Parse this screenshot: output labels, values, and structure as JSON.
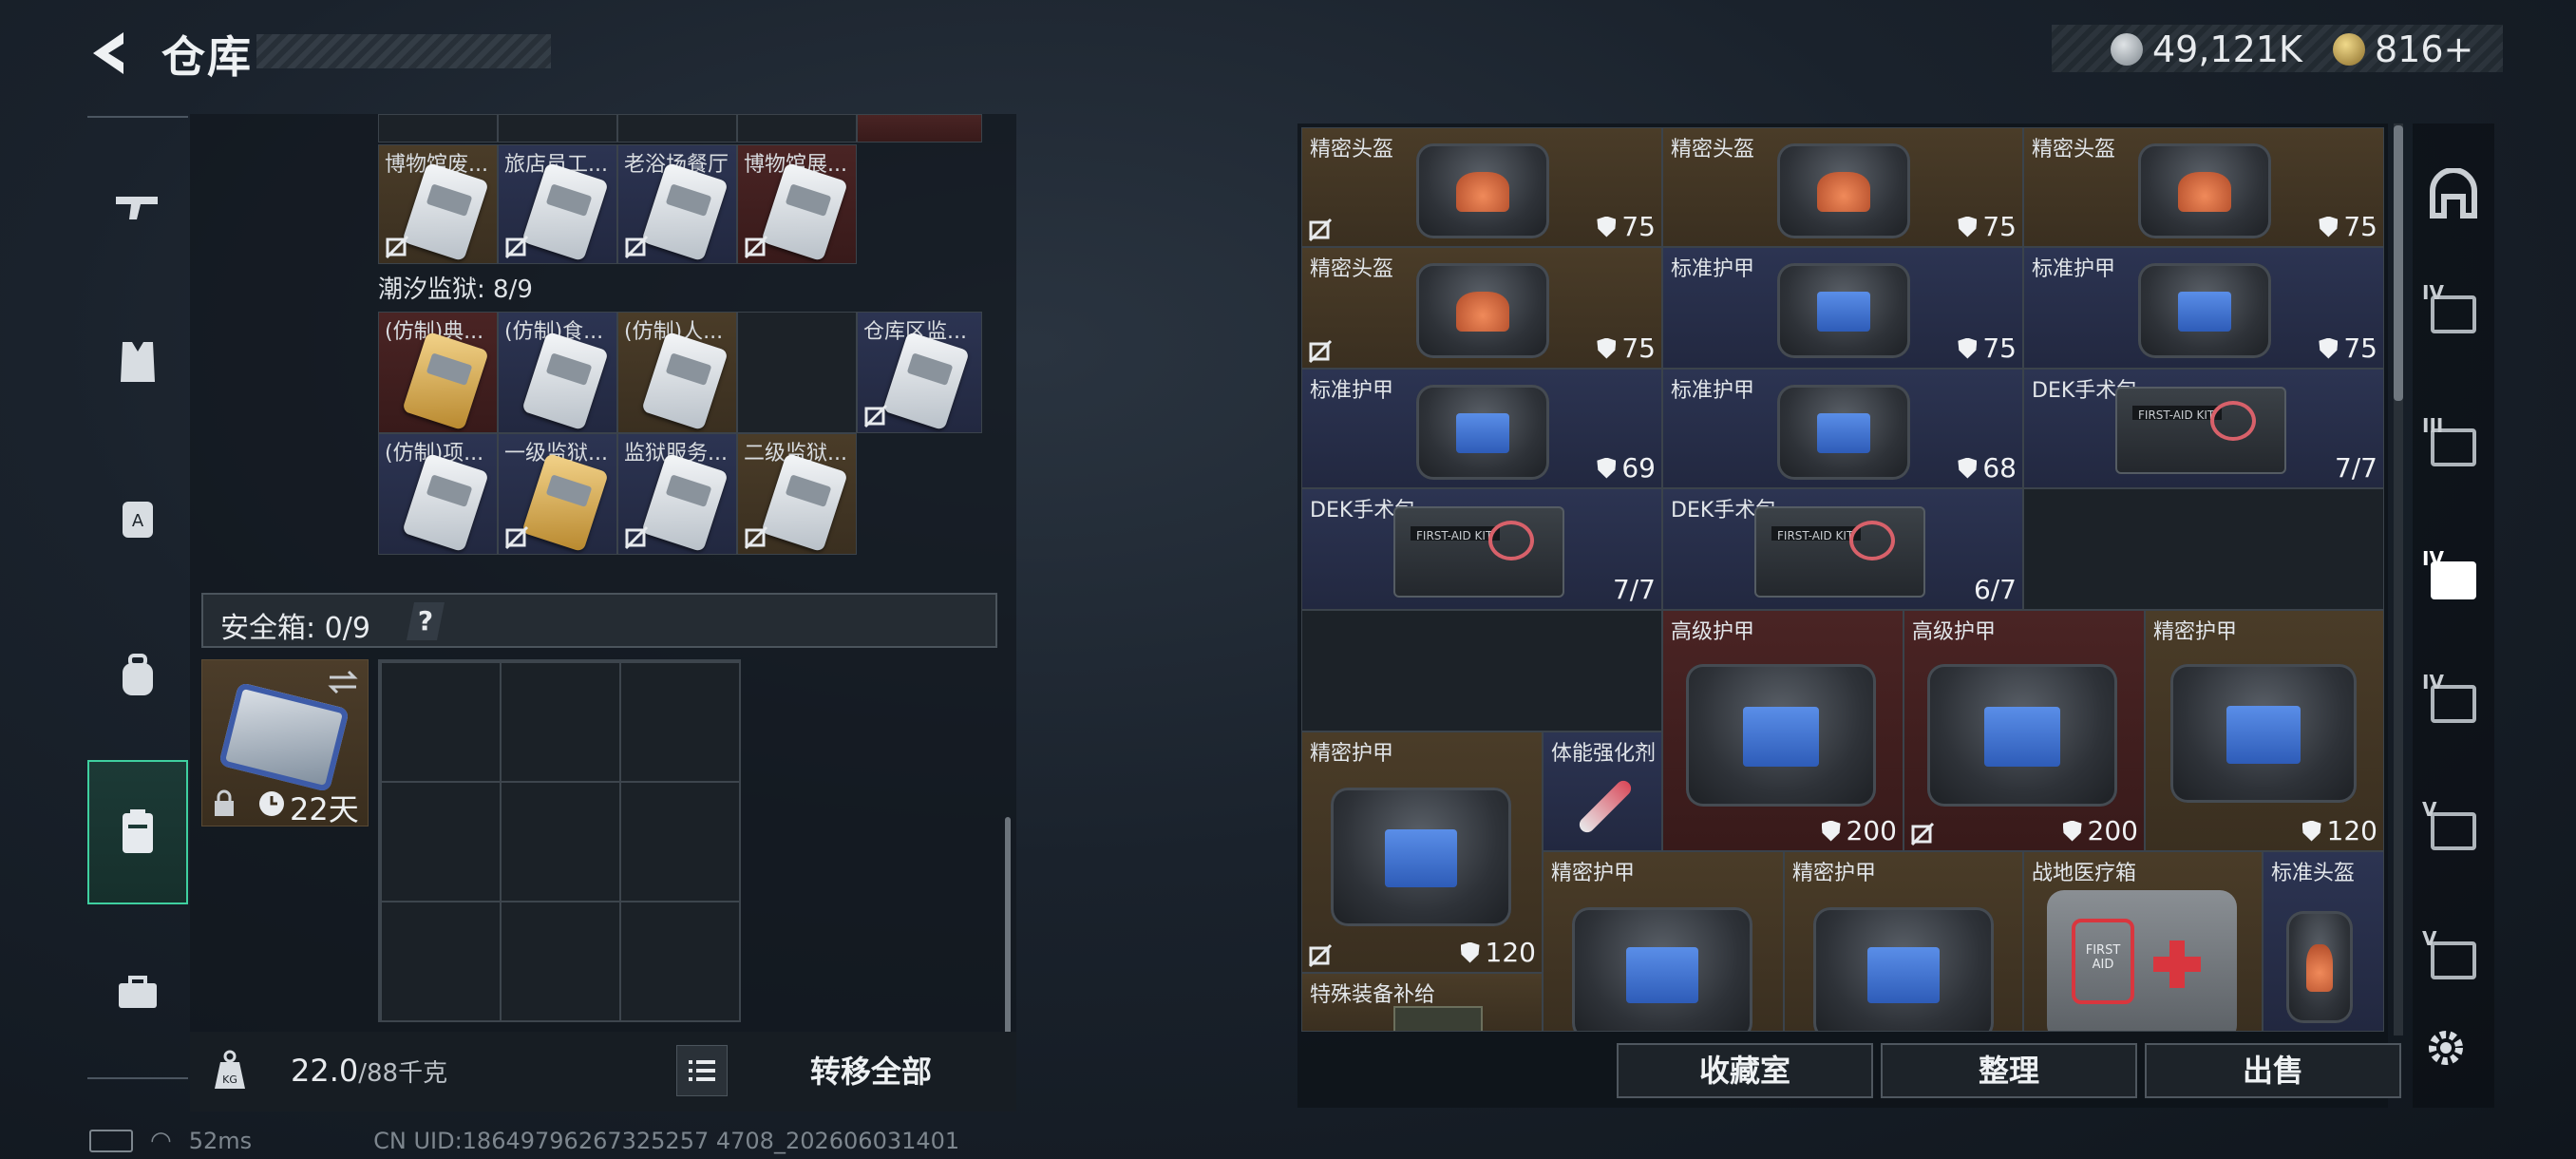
{
  "header": {
    "title": "仓库",
    "currency_1": "49,121K",
    "currency_2": "816+"
  },
  "left_nav": {
    "items": [
      "weapon",
      "armor",
      "chest-rig",
      "backpack",
      "container",
      "toolbox"
    ],
    "active": "container"
  },
  "left_panel": {
    "row_a": [
      {
        "label": "博物馆废...",
        "color": "gold",
        "no_drop": true
      },
      {
        "label": "旅店员工...",
        "color": "blue",
        "no_drop": true
      },
      {
        "label": "老浴场餐厅",
        "color": "blue",
        "no_drop": true
      },
      {
        "label": "博物馆展...",
        "color": "red",
        "no_drop": true
      }
    ],
    "section_title": "潮汐监狱: 8/9",
    "row_b": [
      {
        "label": "(仿制)典...",
        "color": "red",
        "card": "gold",
        "no_drop": false
      },
      {
        "label": "(仿制)食...",
        "color": "blue",
        "no_drop": false
      },
      {
        "label": "(仿制)人...",
        "color": "gold",
        "no_drop": false
      },
      {
        "label": "",
        "color": "dark",
        "empty": true
      },
      {
        "label": "仓库区监...",
        "color": "blue",
        "no_drop": true
      }
    ],
    "row_c": [
      {
        "label": "(仿制)项...",
        "color": "blue",
        "no_drop": false
      },
      {
        "label": "一级监狱...",
        "color": "blue",
        "no_drop": true
      },
      {
        "label": "监狱服务...",
        "color": "blue",
        "no_drop": true
      },
      {
        "label": "二级监狱...",
        "color": "gold",
        "no_drop": true
      }
    ],
    "safe_box": {
      "label": "安全箱: 0/9",
      "help": "?",
      "timer": "22天"
    },
    "weight": {
      "current": "22.0",
      "max": "/88千克"
    },
    "transfer_all": "转移全部"
  },
  "status": {
    "ping": "52ms",
    "uid": "CN UID:18649796267325257 4708_202606031401"
  },
  "right_panel": {
    "items": [
      {
        "label": "精密头盔",
        "value": "75",
        "type": "helmet",
        "bg": "gold",
        "no_drop": true
      },
      {
        "label": "精密头盔",
        "value": "75",
        "type": "helmet",
        "bg": "gold",
        "no_drop": false
      },
      {
        "label": "精密头盔",
        "value": "75",
        "type": "helmet",
        "bg": "gold",
        "no_drop": false
      },
      {
        "label": "精密头盔",
        "value": "75",
        "type": "helmet",
        "bg": "gold",
        "no_drop": true
      },
      {
        "label": "标准护甲",
        "value": "75",
        "type": "armor",
        "bg": "blue",
        "no_drop": false
      },
      {
        "label": "标准护甲",
        "value": "75",
        "type": "armor",
        "bg": "blue",
        "no_drop": false
      },
      {
        "label": "标准护甲",
        "value": "69",
        "type": "armor",
        "bg": "blue",
        "no_drop": false
      },
      {
        "label": "标准护甲",
        "value": "68",
        "type": "armor",
        "bg": "blue",
        "no_drop": false
      },
      {
        "label": "DEK手术包",
        "value": "7/7",
        "type": "medkit",
        "bg": "blue",
        "no_drop": false
      },
      {
        "label": "DEK手术包",
        "value": "7/7",
        "type": "medkit",
        "bg": "blue",
        "no_drop": false
      },
      {
        "label": "DEK手术包",
        "value": "6/7",
        "type": "medkit",
        "bg": "blue",
        "no_drop": false
      },
      {
        "label": "高级护甲",
        "value": "200",
        "type": "armor",
        "bg": "red",
        "no_drop": false
      },
      {
        "label": "高级护甲",
        "value": "200",
        "type": "armor",
        "bg": "red",
        "no_drop": true
      },
      {
        "label": "精密护甲",
        "value": "120",
        "type": "armor",
        "bg": "gold",
        "no_drop": false
      },
      {
        "label": "精密护甲",
        "value": "120",
        "type": "armor",
        "bg": "gold",
        "no_drop": true
      },
      {
        "label": "体能强化剂",
        "value": "",
        "type": "syringe",
        "bg": "blue",
        "no_drop": false
      },
      {
        "label": "精密护甲",
        "value": "",
        "type": "armor",
        "bg": "gold",
        "no_drop": false
      },
      {
        "label": "精密护甲",
        "value": "",
        "type": "armor",
        "bg": "gold",
        "no_drop": false
      },
      {
        "label": "战地医疗箱",
        "value": "",
        "type": "firstaid",
        "bg": "gold",
        "no_drop": false
      },
      {
        "label": "标准头盔",
        "value": "",
        "type": "helmet",
        "bg": "blue",
        "no_drop": false
      },
      {
        "label": "特殊装备补给",
        "value": "",
        "type": "crate",
        "bg": "gold",
        "no_drop": false
      }
    ],
    "buttons": {
      "collection": "收藏室",
      "organize": "整理",
      "sell": "出售"
    },
    "firstaid_text": "FIRST AID",
    "medkit_text": "FIRST-AID KIT"
  },
  "right_nav": {
    "items": [
      {
        "roman": ""
      },
      {
        "roman": "IV"
      },
      {
        "roman": "III"
      },
      {
        "roman": "IV"
      },
      {
        "roman": "IV"
      },
      {
        "roman": "V"
      },
      {
        "roman": "V"
      }
    ]
  }
}
